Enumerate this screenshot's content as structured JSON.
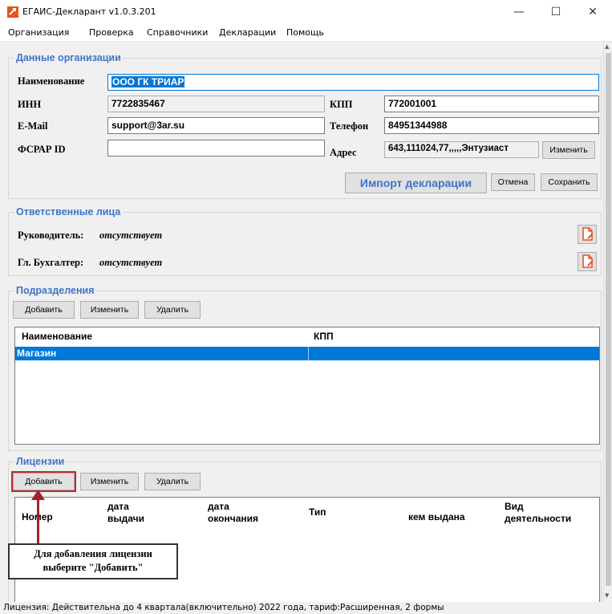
{
  "window": {
    "title": "ЕГАИС-Декларант v1.0.3.201",
    "minimize": "—",
    "maximize": "☐",
    "close": "✕"
  },
  "menu": [
    "Организация",
    "Проверка",
    "Справочники",
    "Декларации",
    "Помощь"
  ],
  "org": {
    "title": "Данные организации",
    "name_label": "Наименование",
    "name_value": "ООО ГК ТРИАР",
    "inn_label": "ИНН",
    "inn_value": "7722835467",
    "kpp_label": "КПП",
    "kpp_value": "772001001",
    "email_label": "E-Mail",
    "email_value": "support@3ar.su",
    "phone_label": "Телефон",
    "phone_value": "84951344988",
    "fsrar_label": "ФСРАР ID",
    "fsrar_value": "",
    "address_label": "Адрес",
    "address_value": "643,111024,77,,,,,Энтузиаст",
    "change_btn": "Изменить",
    "import_btn": "Импорт декларации",
    "cancel_btn": "Отмена",
    "save_btn": "Сохранить"
  },
  "responsible": {
    "title": "Ответственные лица",
    "head_label": "Руководитель:",
    "head_value": "отсутствует",
    "accountant_label": "Гл. Бухгалтер:",
    "accountant_value": "отсутствует"
  },
  "divisions": {
    "title": "Подразделения",
    "add_btn": "Добавить",
    "edit_btn": "Изменить",
    "delete_btn": "Удалить",
    "columns": [
      "Наименование",
      "КПП"
    ],
    "rows": [
      [
        "Магазин",
        ""
      ]
    ]
  },
  "licenses": {
    "title": "Лицензии",
    "add_btn": "Добавить",
    "edit_btn": "Изменить",
    "delete_btn": "Удалить",
    "columns": [
      "Номер",
      "дата\nвыдачи",
      "дата\nокончания",
      "Тип",
      "кем выдана",
      "Вид\nдеятельности"
    ]
  },
  "callout": {
    "text": "Для добавления лицензии\nвыберите \"Добавить\""
  },
  "status": "Лицензия: Действительна до 4 квартала(включительно) 2022 года, тариф:Расширенная, 2 формы",
  "colors": {
    "accent": "#3e74c9",
    "selection": "#0078d7",
    "highlight": "#c0282e"
  }
}
